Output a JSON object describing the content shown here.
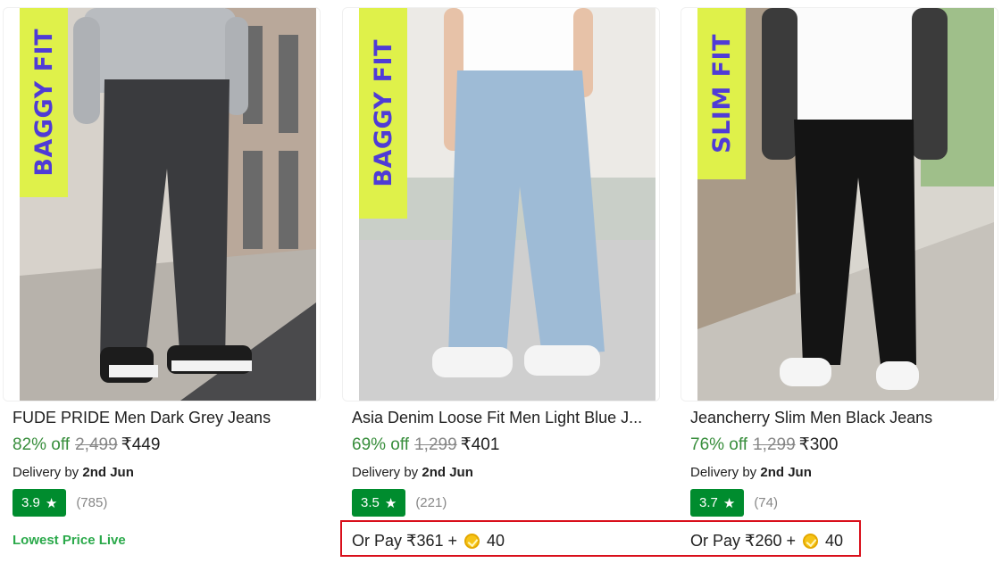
{
  "products": [
    {
      "tag": "BAGGY FIT",
      "title": "FUDE PRIDE Men Dark Grey Jeans",
      "discount": "82% off",
      "mrp": "2,499",
      "price": "₹449",
      "delivery_prefix": "Delivery by",
      "delivery_date": "2nd Jun",
      "rating": "3.9",
      "reviews": "(785)",
      "promo": "Lowest Price Live"
    },
    {
      "tag": "BAGGY FIT",
      "title": "Asia Denim Loose Fit Men Light Blue J...",
      "discount": "69% off",
      "mrp": "1,299",
      "price": "₹401",
      "delivery_prefix": "Delivery by",
      "delivery_date": "2nd Jun",
      "rating": "3.5",
      "reviews": "(221)",
      "or_pay": "Or Pay ₹361 +",
      "coins": "40"
    },
    {
      "tag": "SLIM FIT",
      "title": "Jeancherry Slim Men Black Jeans",
      "discount": "76% off",
      "mrp": "1,299",
      "price": "₹300",
      "delivery_prefix": "Delivery by",
      "delivery_date": "2nd Jun",
      "rating": "3.7",
      "reviews": "(74)",
      "or_pay": "Or Pay ₹260 +",
      "coins": "40"
    }
  ],
  "colors": {
    "discount_green": "#388e3c",
    "rating_badge": "#008c2e",
    "tag_background": "#dff14a",
    "tag_text": "#4f3bd6",
    "highlight_border": "#d90f1b"
  },
  "icons": {
    "rating": "star-icon",
    "coin": "supercoin-icon"
  }
}
